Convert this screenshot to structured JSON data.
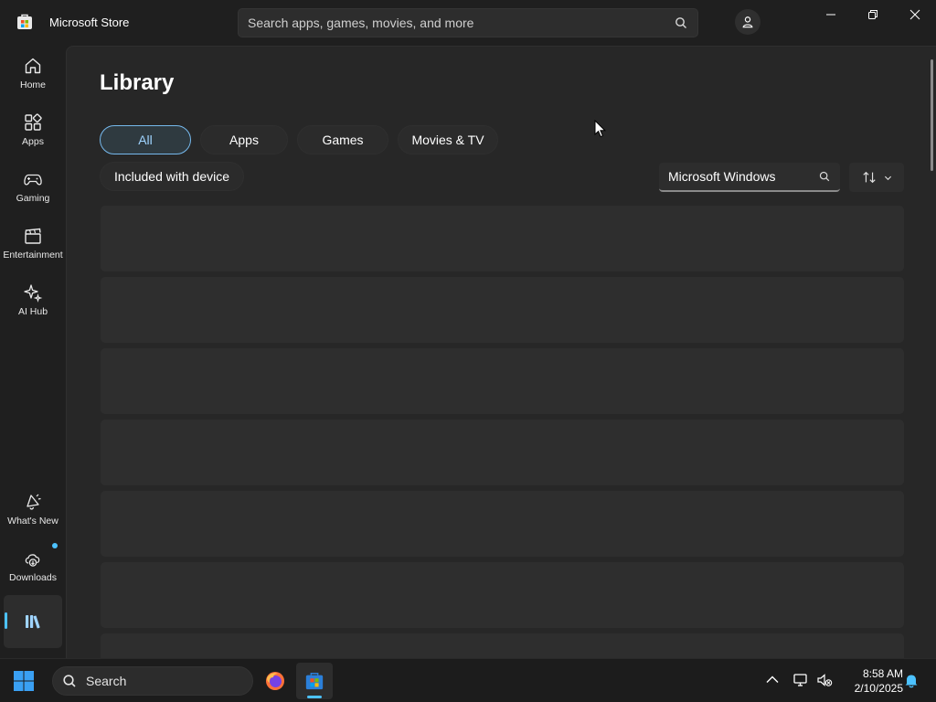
{
  "window": {
    "title": "Microsoft Store",
    "search_placeholder": "Search apps, games, movies, and more"
  },
  "nav": {
    "items": [
      {
        "label": "Home",
        "icon": "home-icon"
      },
      {
        "label": "Apps",
        "icon": "apps-grid-icon"
      },
      {
        "label": "Gaming",
        "icon": "gamepad-icon"
      },
      {
        "label": "Entertainment",
        "icon": "clapperboard-icon"
      },
      {
        "label": "AI Hub",
        "icon": "sparkle-icon"
      }
    ],
    "bottom_items": [
      {
        "label": "What's New",
        "icon": "megaphone-icon"
      },
      {
        "label": "Downloads",
        "icon": "cloud-download-icon"
      },
      {
        "label": "",
        "icon": "library-icon"
      }
    ]
  },
  "library": {
    "title": "Library",
    "filters": [
      "All",
      "Apps",
      "Games",
      "Movies & TV"
    ],
    "selected_filter": "All",
    "extra_filter": "Included with device",
    "search_value": "Microsoft Windows",
    "loading_rows": 7
  },
  "taskbar": {
    "search_label": "Search",
    "time": "8:58 AM",
    "date": "2/10/2025"
  },
  "colors": {
    "accent": "#4cc2ff",
    "selected_chip_border": "#76b9ed",
    "background": "#202020",
    "content": "#272727",
    "row": "#2e2e2e"
  }
}
